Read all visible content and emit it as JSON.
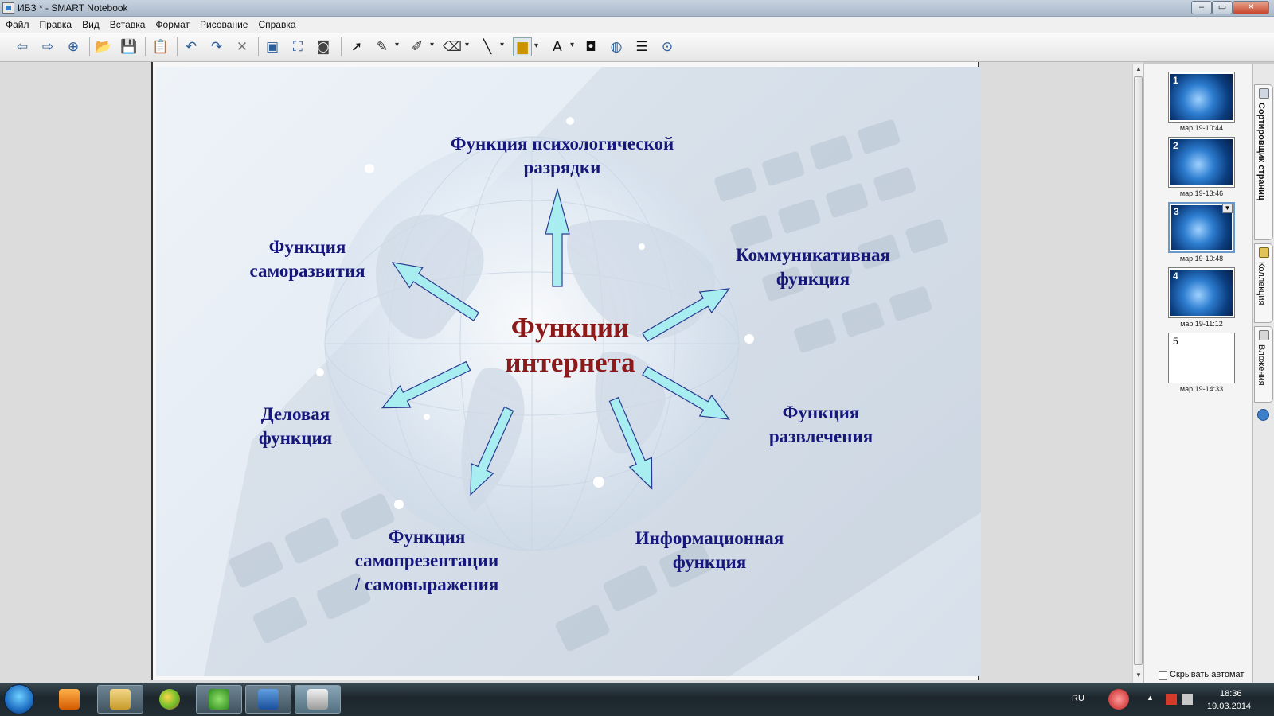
{
  "window": {
    "title": "ИБЗ * - SMART Notebook",
    "close_glyph": "✕",
    "max_glyph": "▭",
    "min_glyph": "–"
  },
  "menu": [
    "Файл",
    "Правка",
    "Вид",
    "Вставка",
    "Формат",
    "Рисование",
    "Справка"
  ],
  "toolbar": {
    "icons": [
      "back-icon",
      "forward-icon",
      "add-page-icon",
      "open-icon",
      "save-icon",
      "paste-icon",
      "undo-icon",
      "redo-icon",
      "delete-icon",
      "screen-shade-icon",
      "fullscreen-icon",
      "capture-icon",
      "select-icon",
      "pen-icon",
      "creative-pen-icon",
      "eraser-icon",
      "line-icon",
      "fill-icon",
      "text-icon",
      "shapes-icon",
      "magic-pen-icon",
      "properties-icon",
      "more-icon"
    ]
  },
  "slide": {
    "center_title": [
      "Функции",
      "интернета"
    ],
    "labels": {
      "top": [
        "Функция психологической",
        "разрядки"
      ],
      "upper_left": [
        "Функция",
        "саморазвития"
      ],
      "upper_right": [
        "Коммуникативная",
        "функция"
      ],
      "left": [
        "Деловая",
        "функция"
      ],
      "right": [
        "Функция",
        "развлечения"
      ],
      "bottom_left": [
        "Функция",
        "самопрезентации",
        "/ самовыражения"
      ],
      "bottom_right": [
        "Информационная",
        "функция"
      ]
    },
    "colors": {
      "center": "#8b1a1a",
      "labels": "#16177a",
      "arrow_fill": "#a8eef0",
      "arrow_stroke": "#2a3b8f"
    }
  },
  "sorter": {
    "pages": [
      {
        "num": "1",
        "time": "мар 19-10:44"
      },
      {
        "num": "2",
        "time": "мар 19-13:46"
      },
      {
        "num": "3",
        "time": "мар 19-10:48"
      },
      {
        "num": "4",
        "time": "мар 19-11:12"
      },
      {
        "num": "5",
        "time": "мар 19-14:33"
      }
    ],
    "autohide": "Скрывать автомат"
  },
  "tabs": {
    "sorter": "Сортировщик страниц",
    "gallery": "Коллекция",
    "attachments": "Вложения"
  },
  "taskbar": {
    "lang": "RU",
    "time": "18:36",
    "date": "19.03.2014"
  }
}
